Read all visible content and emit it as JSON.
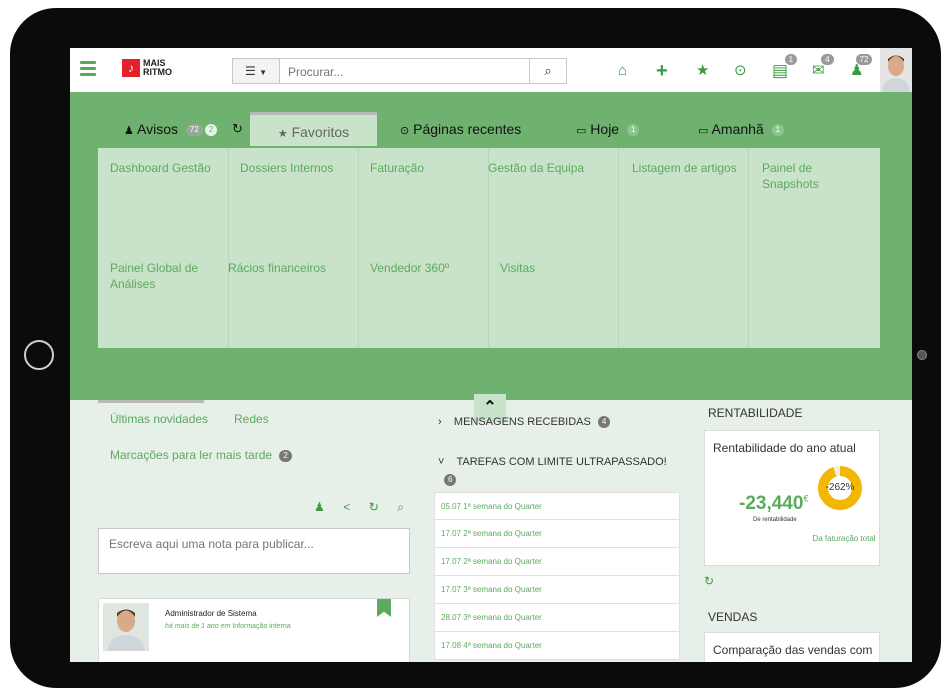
{
  "header": {
    "logo_text_1": "MAIS",
    "logo_text_2": "RITMO",
    "search_filter_icon": "list-icon",
    "search_placeholder": "Procurar...",
    "icons": [
      {
        "name": "home-icon",
        "glyph": "⌂"
      },
      {
        "name": "plus-icon",
        "glyph": "+"
      },
      {
        "name": "star-icon",
        "glyph": "★"
      },
      {
        "name": "clock-icon",
        "glyph": "⊙"
      },
      {
        "name": "clipboard-icon",
        "glyph": "▤",
        "badge": "1"
      },
      {
        "name": "envelope-icon",
        "glyph": "✉",
        "badge": "4"
      },
      {
        "name": "bell-icon",
        "glyph": "♟",
        "badge": "72"
      }
    ]
  },
  "tabs": {
    "avisos": {
      "label": "Avisos",
      "badge1": "72",
      "badge2": "2"
    },
    "favoritos": {
      "label": "Favoritos"
    },
    "recentes": {
      "label": "Páginas recentes"
    },
    "hoje": {
      "label": "Hoje",
      "badge": "1"
    },
    "amanha": {
      "label": "Amanhã",
      "badge": "1"
    }
  },
  "favorites": [
    "Dashboard Gestão",
    "Dossiers Internos",
    "Faturação",
    "Gestão da Equipa",
    "Listagem de artigos",
    "Painel de Snapshots",
    "Painel Global de Análises",
    "Rácios financeiros",
    "Vendedor 360º",
    "Visitas"
  ],
  "left": {
    "tab_novidades": "Últimas novidades",
    "tab_redes": "Redes",
    "marcacoes": "Marcações para ler mais tarde",
    "marcacoes_badge": "2",
    "note_placeholder": "Escreva aqui uma nota para publicar...",
    "post": {
      "author": "Administrador de Sistema",
      "meta_prefix": "há mais de 1 ano em",
      "meta_category": "Informação interna"
    }
  },
  "middle": {
    "messages_label": "MENSAGENS RECEBIDAS",
    "messages_badge": "4",
    "tasks_label": "TAREFAS COM LIMITE ULTRAPASSADO!",
    "tasks_badge": "6",
    "tasks": [
      "05.07 1ª semana do Quarter",
      "17.07 2ª semana do Quarter",
      "17.07 2ª semana do Quarter",
      "17.07 3ª semana do Quarter",
      "28.07 3ª semana do Quarter",
      "17.08 4ª semana do Quarter"
    ]
  },
  "right": {
    "rent_title": "RENTABILIDADE",
    "rent_card_title": "Rentabilidade do ano atual",
    "rent_value": "-23,440",
    "rent_currency": "€",
    "rent_sub": "De rentabilidade",
    "rent_percent": "-262%",
    "rent_percent_fraction": 0.95,
    "rent_note": "Da faturação total",
    "vendas_title": "VENDAS",
    "vendas_card_title": "Comparação das vendas com"
  },
  "colors": {
    "accent": "#5bab5e",
    "panel_green": "#6fb26f",
    "donut": "#f2b705"
  }
}
